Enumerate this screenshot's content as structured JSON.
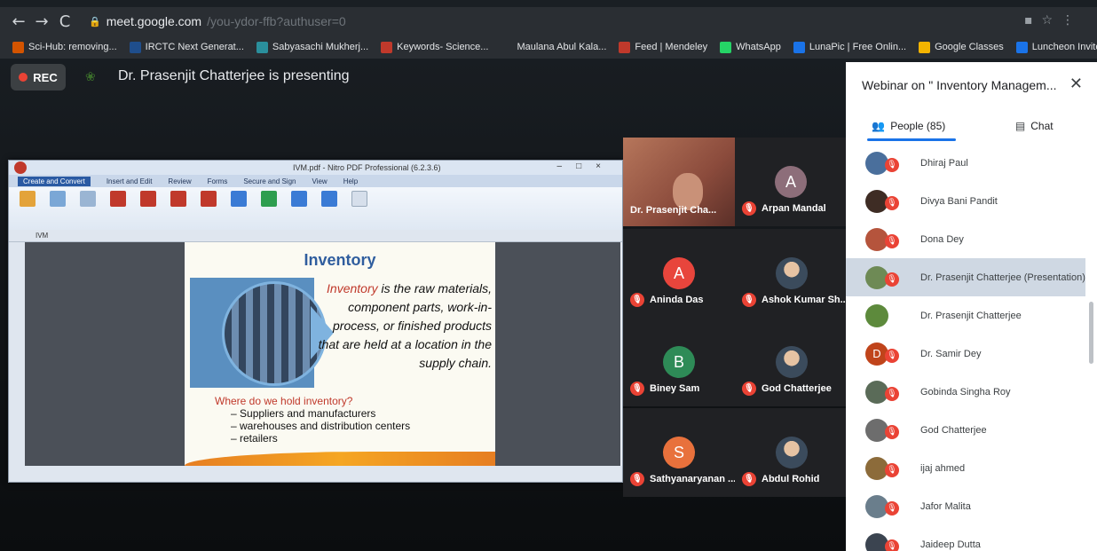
{
  "browser": {
    "url": "meet.google.com",
    "url_rest": "/you-ydor-ffb?authuser=0",
    "bookmarks": [
      {
        "label": "Sci-Hub: removing...",
        "color": "#d35400"
      },
      {
        "label": "IRCTC Next Generat...",
        "color": "#1f4e8c"
      },
      {
        "label": "Sabyasachi Mukherj...",
        "color": "#2a8f9c"
      },
      {
        "label": "Keywords- Science...",
        "color": "#c0392b"
      },
      {
        "label": "Maulana Abul Kala...",
        "color": "#2a2e33"
      },
      {
        "label": "Feed | Mendeley",
        "color": "#c0392b"
      },
      {
        "label": "WhatsApp",
        "color": "#25d366"
      },
      {
        "label": "LunaPic | Free Onlin...",
        "color": "#1a73e8"
      },
      {
        "label": "Google Classes",
        "color": "#f4b400"
      },
      {
        "label": "Luncheon Invite Mo...",
        "color": "#1a73e8"
      }
    ]
  },
  "meet": {
    "rec_label": "REC",
    "presenting": "Dr. Prasenjit Chatterjee is presenting"
  },
  "share": {
    "window_title": "IVM.pdf - Nitro PDF Professional (6.2.3.6)",
    "ribbon_tabs": [
      "Create and Convert",
      "Insert and Edit",
      "Review",
      "Forms",
      "Secure and Sign",
      "View",
      "Help"
    ],
    "doc_tab": "IVM",
    "slide": {
      "title": "Inventory",
      "def_red": "Inventory",
      "def_rest": " is the raw materials, component parts, work-in-process, or finished products that are held at a location in the supply chain.",
      "question": "Where do we hold inventory?",
      "items": [
        "Suppliers and manufacturers",
        "warehouses and distribution centers",
        "retailers"
      ]
    }
  },
  "tiles": [
    {
      "name": "Dr. Prasenjit Cha...",
      "kind": "video"
    },
    {
      "name": "Arpan Mandal",
      "kind": "letter",
      "letter": "A",
      "color": "#8d6e7a"
    },
    {
      "name": "Aninda Das",
      "kind": "letter",
      "letter": "A",
      "color": "#e8453c"
    },
    {
      "name": "Ashok Kumar Sh...",
      "kind": "photo"
    },
    {
      "name": "Biney Sam",
      "kind": "letter",
      "letter": "B",
      "color": "#2e8b57"
    },
    {
      "name": "God Chatterjee",
      "kind": "photo"
    },
    {
      "name": "Sathyanaryanan ...",
      "kind": "letter",
      "letter": "S",
      "color": "#e8713c"
    },
    {
      "name": "Abdul Rohid",
      "kind": "photo"
    }
  ],
  "panel": {
    "title": "Webinar on \" Inventory Managem...",
    "people_tab": "People (85)",
    "chat_tab": "Chat",
    "people": [
      {
        "name": "Dhiraj Paul",
        "avatar": "#4a6f9c"
      },
      {
        "name": "Divya Bani Pandit",
        "avatar": "#3e2c24"
      },
      {
        "name": "Dona Dey",
        "avatar": "#b5543c"
      },
      {
        "name": "Dr. Prasenjit Chatterjee (Presentation)",
        "avatar": "#6e8a55"
      },
      {
        "name": "Dr. Prasenjit Chatterjee",
        "avatar": "#5d8a3c"
      },
      {
        "name": "Dr. Samir Dey",
        "avatar": "#c0441b",
        "letter": "D"
      },
      {
        "name": "Gobinda Singha Roy",
        "avatar": "#5a6b58"
      },
      {
        "name": "God Chatterjee",
        "avatar": "#6d6d6d"
      },
      {
        "name": "ijaj ahmed",
        "avatar": "#8c6b3a"
      },
      {
        "name": "Jafor Malita",
        "avatar": "#6a7e8c"
      },
      {
        "name": "Jaideep Dutta",
        "avatar": "#3b4450"
      }
    ]
  }
}
